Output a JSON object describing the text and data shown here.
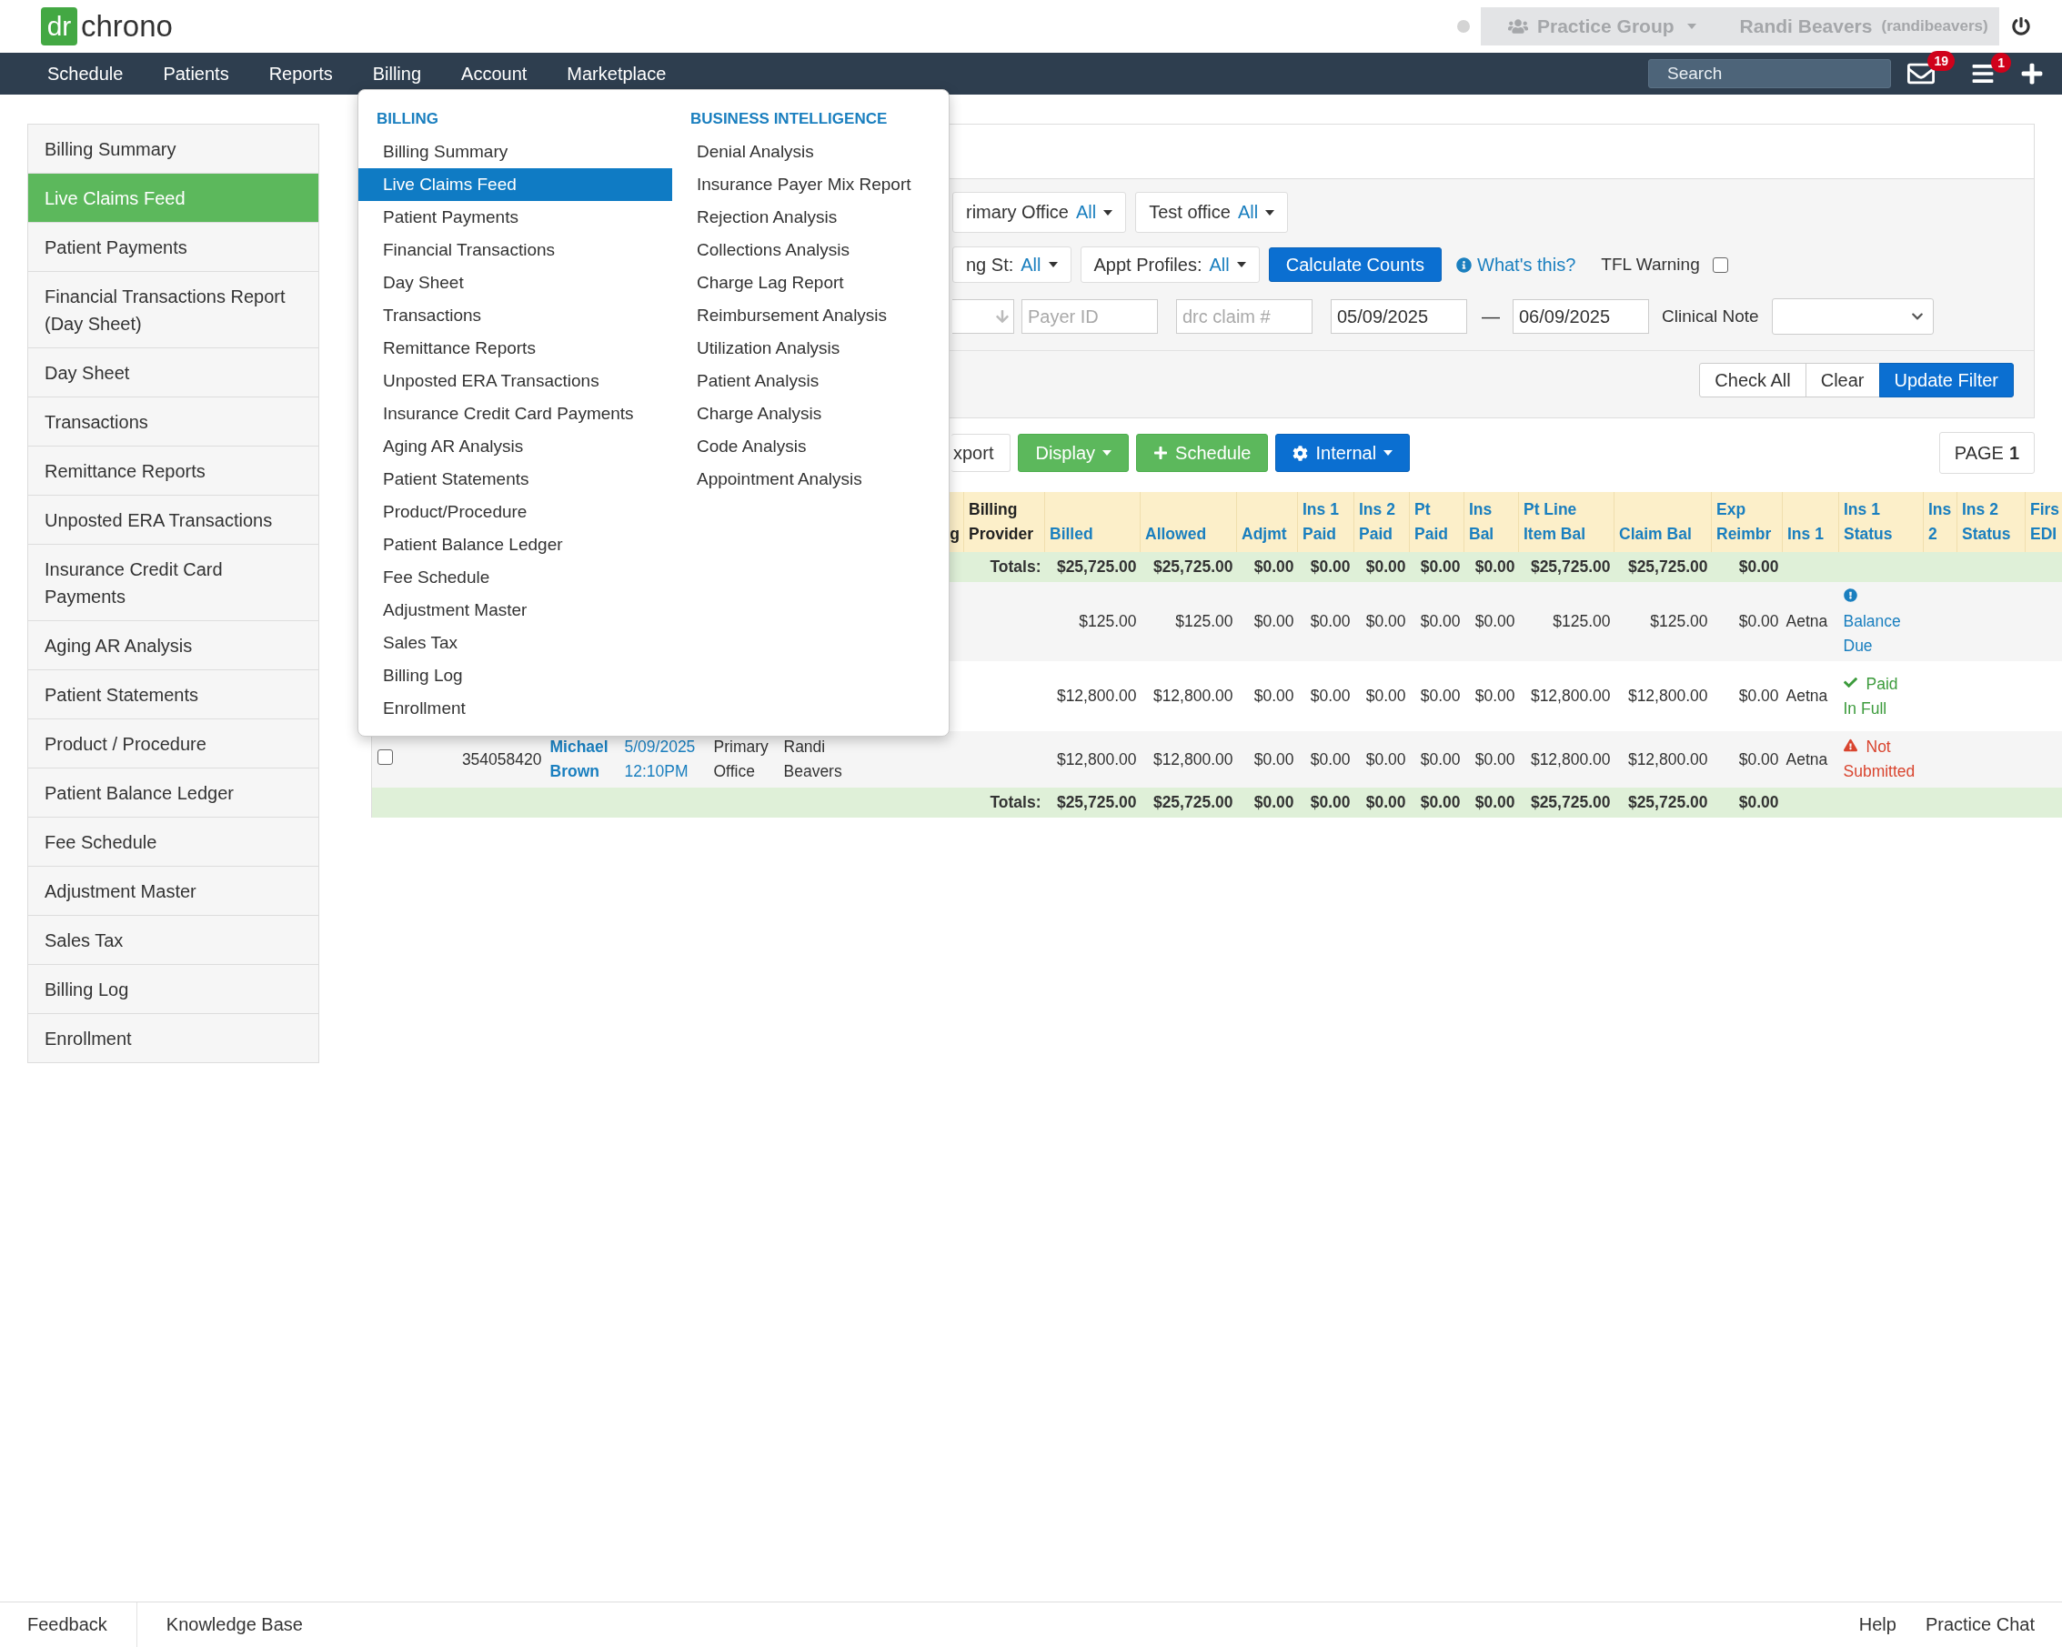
{
  "logo": {
    "mark": "dr",
    "word": "chrono"
  },
  "user_bar": {
    "practice": "Practice Group",
    "user": "Randi Beavers",
    "username": "(randibeavers)"
  },
  "nav": [
    {
      "label": "Schedule"
    },
    {
      "label": "Patients"
    },
    {
      "label": "Reports"
    },
    {
      "label": "Billing"
    },
    {
      "label": "Account"
    },
    {
      "label": "Marketplace"
    }
  ],
  "search": {
    "placeholder": "Search"
  },
  "badges": {
    "messages": "19",
    "tasks": "1"
  },
  "sidebar": [
    {
      "label": "Billing Summary",
      "selected": false
    },
    {
      "label": "Live Claims Feed",
      "selected": true
    },
    {
      "label": "Patient Payments",
      "selected": false
    },
    {
      "label": "Financial Transactions Report (Day Sheet)",
      "selected": false
    },
    {
      "label": "Day Sheet",
      "selected": false
    },
    {
      "label": "Transactions",
      "selected": false
    },
    {
      "label": "Remittance Reports",
      "selected": false
    },
    {
      "label": "Unposted ERA Transactions",
      "selected": false
    },
    {
      "label": "Insurance Credit Card Payments",
      "selected": false
    },
    {
      "label": "Aging AR Analysis",
      "selected": false
    },
    {
      "label": "Patient Statements",
      "selected": false
    },
    {
      "label": "Product / Procedure",
      "selected": false
    },
    {
      "label": "Patient Balance Ledger",
      "selected": false
    },
    {
      "label": "Fee Schedule",
      "selected": false
    },
    {
      "label": "Adjustment Master",
      "selected": false
    },
    {
      "label": "Sales Tax",
      "selected": false
    },
    {
      "label": "Billing Log",
      "selected": false
    },
    {
      "label": "Enrollment",
      "selected": false
    }
  ],
  "billing_menu": {
    "columns": [
      {
        "heading": "BILLING",
        "items": [
          {
            "label": "Billing Summary",
            "selected": false
          },
          {
            "label": "Live Claims Feed",
            "selected": true
          },
          {
            "label": "Patient Payments",
            "selected": false
          },
          {
            "label": "Financial Transactions",
            "selected": false
          },
          {
            "label": "Day Sheet",
            "selected": false
          },
          {
            "label": "Transactions",
            "selected": false
          },
          {
            "label": "Remittance Reports",
            "selected": false
          },
          {
            "label": "Unposted ERA Transactions",
            "selected": false
          },
          {
            "label": "Insurance Credit Card Payments",
            "selected": false
          },
          {
            "label": "Aging AR Analysis",
            "selected": false
          },
          {
            "label": "Patient Statements",
            "selected": false
          },
          {
            "label": "Product/Procedure",
            "selected": false
          },
          {
            "label": "Patient Balance Ledger",
            "selected": false
          },
          {
            "label": "Fee Schedule",
            "selected": false
          },
          {
            "label": "Adjustment Master",
            "selected": false
          },
          {
            "label": "Sales Tax",
            "selected": false
          },
          {
            "label": "Billing Log",
            "selected": false
          },
          {
            "label": "Enrollment",
            "selected": false
          }
        ]
      },
      {
        "heading": "BUSINESS INTELLIGENCE",
        "items": [
          {
            "label": "Denial Analysis",
            "selected": false
          },
          {
            "label": "Insurance Payer Mix Report",
            "selected": false
          },
          {
            "label": "Rejection Analysis",
            "selected": false
          },
          {
            "label": "Collections Analysis",
            "selected": false
          },
          {
            "label": "Charge Lag Report",
            "selected": false
          },
          {
            "label": "Reimbursement Analysis",
            "selected": false
          },
          {
            "label": "Utilization Analysis",
            "selected": false
          },
          {
            "label": "Patient Analysis",
            "selected": false
          },
          {
            "label": "Charge Analysis",
            "selected": false
          },
          {
            "label": "Code Analysis",
            "selected": false
          },
          {
            "label": "Appointment Analysis",
            "selected": false
          }
        ]
      }
    ]
  },
  "filters": {
    "row1": [
      {
        "label": "rimary Office",
        "value": "All"
      },
      {
        "label": "Test office",
        "value": "All"
      }
    ],
    "row2": [
      {
        "label": "ng St:",
        "value": "All"
      },
      {
        "label": "Appt Profiles:",
        "value": "All"
      }
    ],
    "calculate": "Calculate Counts",
    "help": "What's this?",
    "tfl": {
      "label": "TFL Warning",
      "checked": false
    },
    "payer_id": {
      "placeholder": "Payer ID"
    },
    "claim_number": {
      "placeholder": "drc claim #"
    },
    "date_from": "05/09/2025",
    "separator": "—",
    "date_to": "06/09/2025",
    "clinical_note": {
      "label": "Clinical Note"
    },
    "buttons": [
      {
        "label": "Check All",
        "primary": false
      },
      {
        "label": "Clear",
        "primary": false
      },
      {
        "label": "Update Filter",
        "primary": true
      }
    ]
  },
  "actions": [
    {
      "label": "xport",
      "kind": "default",
      "caret": false
    },
    {
      "label": "Display",
      "kind": "success",
      "caret": true
    },
    {
      "label": "Schedule",
      "kind": "success",
      "caret": false
    },
    {
      "label": "Internal",
      "kind": "primary",
      "caret": true
    }
  ],
  "page": {
    "label": "PAGE",
    "number": "1"
  },
  "table": {
    "lead_header": "g",
    "columns": [
      {
        "label": "Billing Provider",
        "sortable": false
      },
      {
        "label": "Billed",
        "sortable": true
      },
      {
        "label": "Allowed",
        "sortable": true
      },
      {
        "label": "Adjmt",
        "sortable": true
      },
      {
        "label": "Ins 1 Paid",
        "sortable": true
      },
      {
        "label": "Ins 2 Paid",
        "sortable": true
      },
      {
        "label": "Pt Paid",
        "sortable": true
      },
      {
        "label": "Ins Bal",
        "sortable": true
      },
      {
        "label": "Pt Line Item Bal",
        "sortable": true
      },
      {
        "label": "Claim Bal",
        "sortable": true
      },
      {
        "label": "Exp Reimbr",
        "sortable": true
      },
      {
        "label": "Ins 1",
        "sortable": true
      },
      {
        "label": "Ins 1 Status",
        "sortable": true
      },
      {
        "label": "Ins 2",
        "sortable": true
      },
      {
        "label": "Ins 2 Status",
        "sortable": true
      },
      {
        "label": "Firs EDI",
        "sortable": true
      }
    ],
    "totals_label": "Totals:",
    "totals": [
      "$25,725.00",
      "$25,725.00",
      "$0.00",
      "$0.00",
      "$0.00",
      "$0.00",
      "$0.00",
      "$25,725.00",
      "$25,725.00",
      "$0.00"
    ],
    "rows": [
      {
        "values": [
          "$125.00",
          "$125.00",
          "$0.00",
          "$0.00",
          "$0.00",
          "$0.00",
          "$0.00",
          "$125.00",
          "$125.00",
          "$0.00"
        ],
        "ins1": "Aetna",
        "status": {
          "kind": "balance_due",
          "label": "Balance Due"
        }
      },
      {
        "values": [
          "$12,800.00",
          "$12,800.00",
          "$0.00",
          "$0.00",
          "$0.00",
          "$0.00",
          "$0.00",
          "$12,800.00",
          "$12,800.00",
          "$0.00"
        ],
        "ins1": "Aetna",
        "status": {
          "kind": "paid",
          "label": "Paid In Full"
        }
      },
      {
        "lead": {
          "checked": false,
          "claim_id": "354058420",
          "patient": "Michael Brown",
          "date": "5/09/2025",
          "time": "12:10PM",
          "office": "Primary Office",
          "provider": "Randi Beavers"
        },
        "values": [
          "$12,800.00",
          "$12,800.00",
          "$0.00",
          "$0.00",
          "$0.00",
          "$0.00",
          "$0.00",
          "$12,800.00",
          "$12,800.00",
          "$0.00"
        ],
        "ins1": "Aetna",
        "status": {
          "kind": "not_submitted",
          "label": "Not Submitted"
        }
      }
    ],
    "footer_totals_label": "Totals:",
    "footer_totals": [
      "$25,725.00",
      "$25,725.00",
      "$0.00",
      "$0.00",
      "$0.00",
      "$0.00",
      "$0.00",
      "$25,725.00",
      "$25,725.00",
      "$0.00"
    ]
  },
  "footer": {
    "left": [
      "Feedback",
      "Knowledge Base"
    ],
    "right": [
      "Help",
      "Practice Chat"
    ]
  }
}
